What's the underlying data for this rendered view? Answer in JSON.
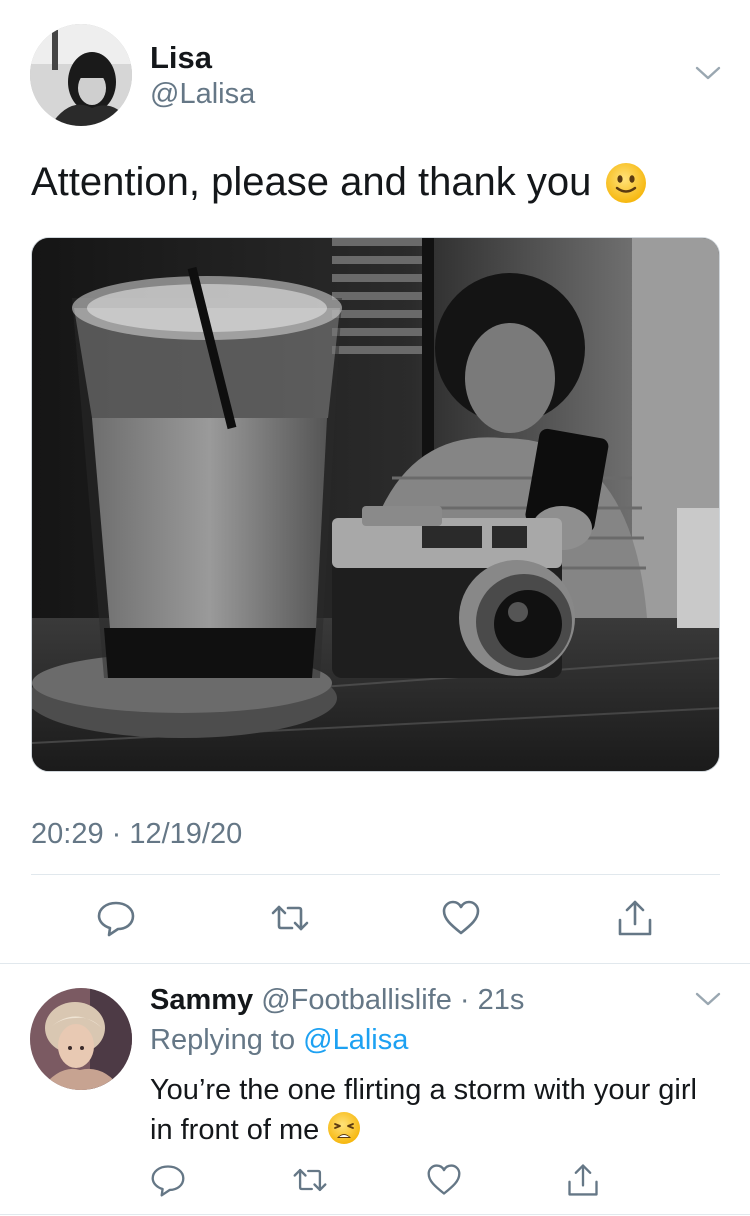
{
  "tweet": {
    "author_name": "Lisa",
    "author_handle": "@Lalisa",
    "text": "Attention, please and thank you",
    "emoji": "slightly-smiling-face",
    "timestamp": "20:29 · 12/19/20",
    "actions": [
      "reply-icon",
      "retweet-icon",
      "like-icon",
      "share-icon"
    ]
  },
  "reply": {
    "author_name": "Sammy",
    "handle_and_time": "@Footballislife · 21s",
    "replying_prefix": "Replying to",
    "replying_to": "@Lalisa",
    "text": "You’re the one flirting a storm with your girl in front of me",
    "emoji": "weary-face",
    "actions": [
      "reply-icon",
      "retweet-icon",
      "like-icon",
      "share-icon"
    ]
  },
  "colors": {
    "primary_text": "#14171a",
    "secondary_text": "#657786",
    "link": "#1da1f2",
    "divider": "#e1e8ed"
  }
}
